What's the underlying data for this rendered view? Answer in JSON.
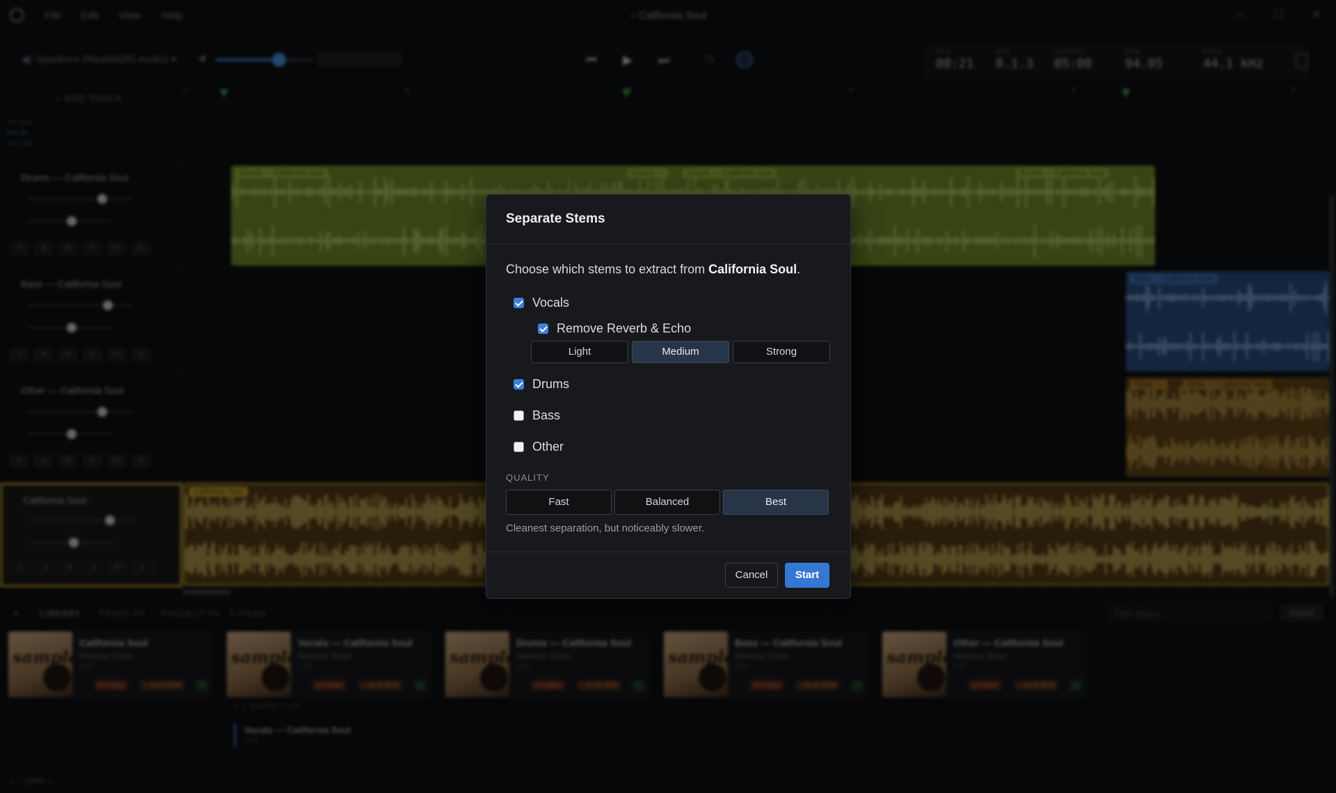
{
  "app": {
    "title": "– California Soul",
    "menu": [
      "File",
      "Edit",
      "View",
      "Help"
    ]
  },
  "transport": {
    "output_device": "Speakers (Realtek(R) Audio)",
    "volume_level": 0.65,
    "readouts": [
      {
        "label": "POS",
        "value": "00:21"
      },
      {
        "label": "BAR",
        "value": "8.1.3"
      },
      {
        "label": "LENGTH",
        "value": "05:00"
      },
      {
        "label": "BPM",
        "value": "94.05"
      },
      {
        "label": "RATE",
        "value": "44.1 kHz"
      }
    ]
  },
  "timeline": {
    "add_track_label": "ADD TRACK",
    "lane_labels": [
      "LPF 100%",
      "HPF 4%",
      "LPF 100%"
    ],
    "ruler": [
      "1",
      "2",
      "3",
      "4",
      "5",
      "6"
    ]
  },
  "tracks": [
    {
      "name": "Drums — California Soul",
      "color": "#9ab53d"
    },
    {
      "name": "Bass — California Soul",
      "color": "#3f76b8"
    },
    {
      "name": "Other — California Soul",
      "color": "#a9782a"
    },
    {
      "name": "California Soul",
      "color": "#c9a232"
    }
  ],
  "clips": {
    "drums": [
      "Drums — California Soul",
      "Drums —",
      "Drums — California Soul",
      "Drums — California Soul"
    ],
    "bass": [
      "Bass — California Soul"
    ],
    "other": [
      "Other —",
      "Other — California Soul"
    ],
    "main": [
      "California Soul"
    ]
  },
  "library": {
    "tabs": [
      "LIBRARY",
      "TRACK FX",
      "PROJECT FX",
      "5 ITEMS"
    ],
    "filter_placeholder": "Filter library",
    "import_label": "Import",
    "items": [
      {
        "title": "California Soul",
        "artist": "Marlena Shaw",
        "duration": "2:57",
        "key": "C# major",
        "bpm": "~ 94.05 BPM"
      },
      {
        "title": "Vocals — California Soul",
        "artist": "Marlena Shaw",
        "duration": "2:57",
        "key": "C# major",
        "bpm": "~ 94.05 BPM"
      },
      {
        "title": "Drums — California Soul",
        "artist": "Marlena Shaw",
        "duration": "2:57",
        "key": "C# major",
        "bpm": "~ 94.05 BPM"
      },
      {
        "title": "Bass — California Soul",
        "artist": "Marlena Shaw",
        "duration": "2:57",
        "key": "C# major",
        "bpm": "~ 94.05 BPM"
      },
      {
        "title": "Other — California Soul",
        "artist": "Marlena Shaw",
        "duration": "2:57",
        "key": "C# major",
        "bpm": "~ 94.05 BPM"
      }
    ],
    "saved_clip_label": "1 SAVED CLIP",
    "saved_clip": {
      "title": "Vocals — California Soul",
      "duration": "0:26"
    },
    "zoom": "100%"
  },
  "modal": {
    "title": "Separate Stems",
    "prompt_prefix": "Choose which stems to extract from ",
    "prompt_song": "California Soul",
    "prompt_suffix": ".",
    "stems": [
      {
        "label": "Vocals",
        "checked": true
      },
      {
        "label": "Drums",
        "checked": true
      },
      {
        "label": "Bass",
        "checked": false
      },
      {
        "label": "Other",
        "checked": false
      }
    ],
    "reverb": {
      "label": "Remove Reverb & Echo",
      "checked": true,
      "levels": [
        "Light",
        "Medium",
        "Strong"
      ],
      "selected": "Medium"
    },
    "quality_label": "QUALITY",
    "quality_options": [
      "Fast",
      "Balanced",
      "Best"
    ],
    "quality_selected": "Best",
    "quality_hint": "Cleanest separation, but noticeably slower.",
    "cancel_label": "Cancel",
    "start_label": "Start"
  },
  "colors": {
    "accent": "#3478d4",
    "drums_clip": "#8fa935",
    "bass_clip": "#2e5f9a",
    "other_clip": "#8a5f22",
    "main_clip": "#7a5a1e"
  }
}
